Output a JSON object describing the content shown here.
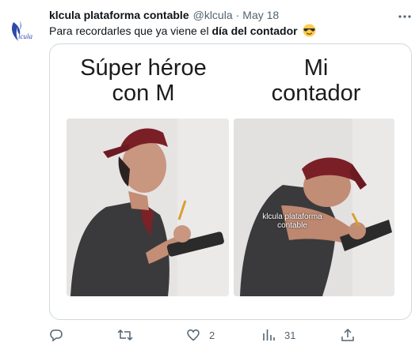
{
  "tweet": {
    "avatar_text": "lcula",
    "name": "klcula plataforma contable",
    "handle": "@klcula",
    "separator": "·",
    "date": "May 18",
    "text_before": "Para recordarles que ya viene el ",
    "text_bold": "día del contador",
    "emoji": "smiling-face-with-sunglasses"
  },
  "meme": {
    "left_caption": "Súper héroe\ncon M",
    "right_caption": "Mi\ncontador",
    "overlay_text": "klcula plataforma\ncontable"
  },
  "actions": {
    "replies": "",
    "retweets": "",
    "likes": "2",
    "views": "31"
  },
  "colors": {
    "muted": "#536471",
    "brand": "#2b4aa8"
  }
}
